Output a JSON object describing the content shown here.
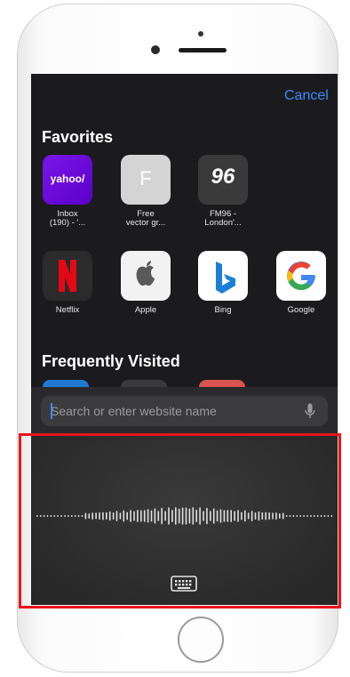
{
  "header": {
    "cancel_label": "Cancel"
  },
  "favorites": {
    "title": "Favorites",
    "items": [
      {
        "label": "Inbox\n(190) - '...",
        "icon": "yahoo-icon",
        "icon_text": "yahoo/",
        "color": "#6001d2"
      },
      {
        "label": "Free\nvector gr...",
        "icon": "letter-f-icon",
        "icon_text": "F",
        "color": "#d9d9d9"
      },
      {
        "label": "FM96 -\nLondon'...",
        "icon": "fm96-icon",
        "icon_text": "96",
        "color": "#3a3a3a"
      },
      {
        "label": "Netflix",
        "icon": "netflix-icon",
        "icon_text": "",
        "color": "#2b2b2b"
      },
      {
        "label": "Apple",
        "icon": "apple-icon",
        "icon_text": "",
        "color": "#f2f2f2"
      },
      {
        "label": "Bing",
        "icon": "bing-icon",
        "icon_text": "",
        "color": "#ffffff"
      },
      {
        "label": "Google",
        "icon": "google-icon",
        "icon_text": "",
        "color": "#ffffff"
      }
    ]
  },
  "frequently_visited": {
    "title": "Frequently Visited"
  },
  "search": {
    "placeholder": "Search or enter website name",
    "value": ""
  },
  "dictation": {
    "icon": "keyboard-icon"
  },
  "colors": {
    "accent": "#3d8bff",
    "highlight": "#e8141c"
  }
}
